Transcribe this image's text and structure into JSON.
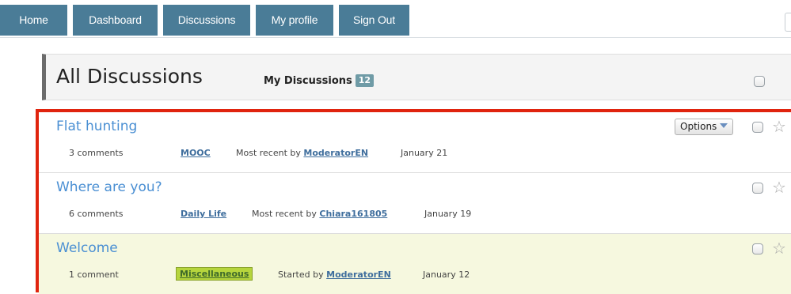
{
  "nav": {
    "tabs": [
      {
        "label": "Home"
      },
      {
        "label": "Dashboard"
      },
      {
        "label": "Discussions"
      },
      {
        "label": "My profile"
      },
      {
        "label": "Sign Out"
      }
    ]
  },
  "header": {
    "title": "All Discussions",
    "my_discussions_label": "My Discussions",
    "my_discussions_count": "12"
  },
  "discussions": [
    {
      "title": "Flat hunting",
      "comments": "3 comments",
      "category": "MOOC",
      "activity_prefix": "Most recent by",
      "user": "ModeratorEN",
      "date": "January 21",
      "options_label": "Options"
    },
    {
      "title": "Where are you?",
      "comments": "6 comments",
      "category": "Daily Life",
      "activity_prefix": "Most recent by",
      "user": "Chiara161805",
      "date": "January 19"
    },
    {
      "title": "Welcome",
      "comments": "1 comment",
      "category": "Miscellaneous",
      "activity_prefix": "Started by",
      "user": "ModeratorEN",
      "date": "January 12",
      "highlighted": true
    }
  ],
  "colors": {
    "nav_tab": "#4a7c97",
    "link": "#4a8fd3",
    "list_border": "#e0240e",
    "highlight_row": "#f6f8df",
    "category_highlight": "#b6d53d",
    "count_badge": "#6f9ba6"
  },
  "icons": {
    "star": "star-outline-icon",
    "options_caret": "caret-down-icon"
  }
}
